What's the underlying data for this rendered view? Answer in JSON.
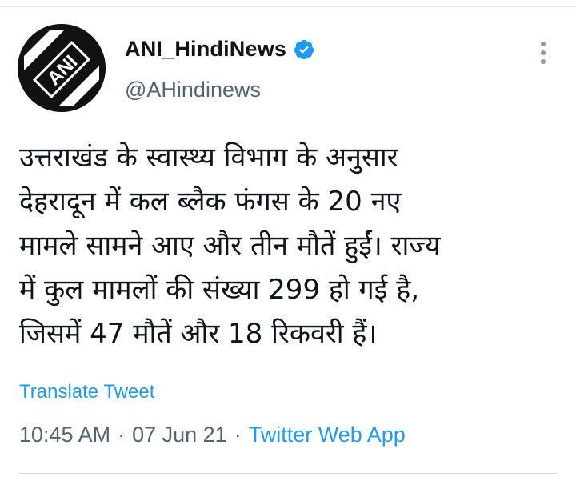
{
  "tweet": {
    "author": {
      "display_name": "ANI_HindiNews",
      "handle": "@AHindinews",
      "verified": true,
      "avatar_icon": "ani-logo-icon",
      "avatar_text": "ANI"
    },
    "text_lines": [
      "उत्तराखंड के स्वास्थ्य विभाग के अनुसार",
      "देहरादून में कल ब्लैक फंगस के 20 नए",
      "मामले सामने आए और तीन मौतें हुईं। राज्य",
      "में कुल मामलों की संख्या 299 हो गई है,",
      "जिसमें 47 मौतें और 18 रिकवरी हैं।"
    ],
    "translate_label": "Translate Tweet",
    "time": "10:45 AM",
    "date": "07 Jun 21",
    "separator": "·",
    "source": "Twitter Web App"
  },
  "icons": {
    "more": "more-vertical-icon",
    "verified": "verified-badge-icon"
  },
  "colors": {
    "link": "#1d9bf0",
    "muted": "#536471",
    "text": "#0f1419"
  }
}
